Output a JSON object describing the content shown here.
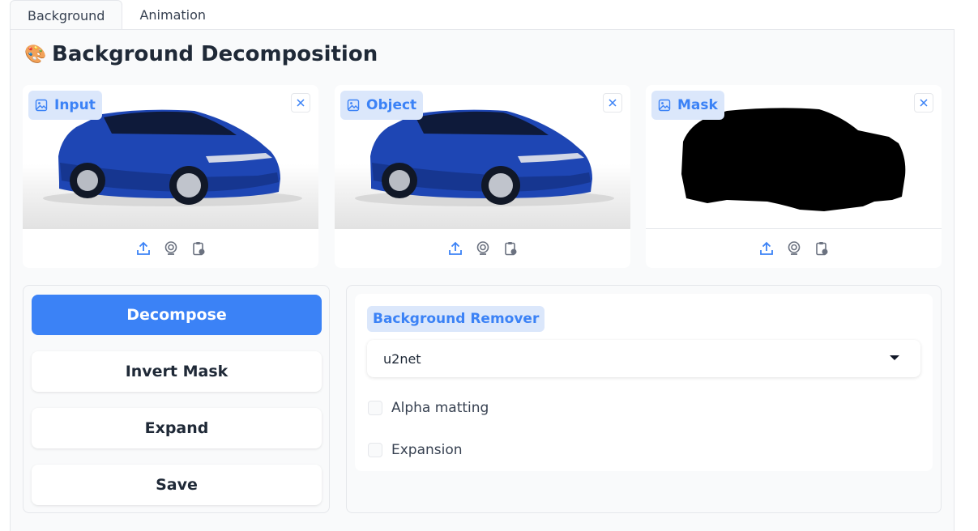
{
  "tabs": [
    {
      "label": "Background",
      "active": true
    },
    {
      "label": "Animation",
      "active": false
    }
  ],
  "title": {
    "emoji": "🎨",
    "text": "Background Decomposition"
  },
  "images": [
    {
      "label": "Input",
      "content": "blue SUV photo"
    },
    {
      "label": "Object",
      "content": "blue SUV cutout"
    },
    {
      "label": "Mask",
      "content": "black silhouette"
    }
  ],
  "image_tool_icons": [
    "upload-icon",
    "webcam-icon",
    "clipboard-icon"
  ],
  "buttons": {
    "decompose": "Decompose",
    "invert_mask": "Invert Mask",
    "expand": "Expand",
    "save": "Save"
  },
  "options": {
    "remover_label": "Background Remover",
    "remover_value": "u2net",
    "alpha_matting": {
      "label": "Alpha matting",
      "checked": false
    },
    "expansion": {
      "label": "Expansion",
      "checked": false
    }
  },
  "colors": {
    "accent": "#3b82f6",
    "label_bg": "#dbe7fb",
    "car_blue": "#1e46b4"
  }
}
